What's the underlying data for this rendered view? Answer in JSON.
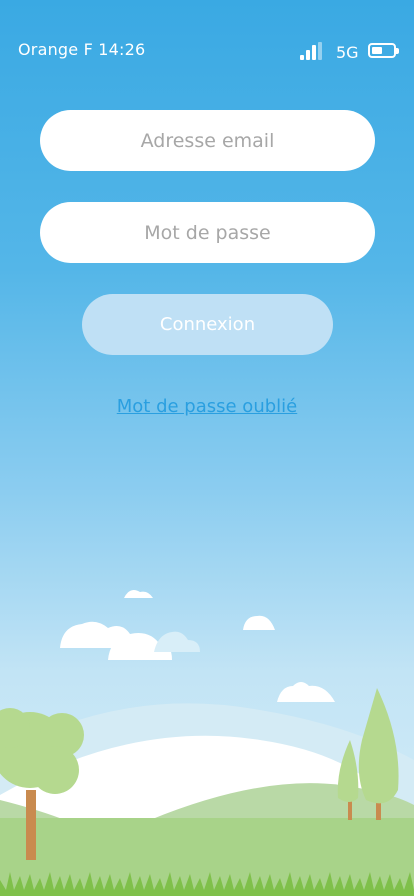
{
  "status_bar": {
    "carrier_time": "Orange F 14:26",
    "network": "5G",
    "battery_level": 0.5,
    "signal_icon": "signal-bars-icon",
    "battery_icon": "battery-icon"
  },
  "login": {
    "email_placeholder": "Adresse email",
    "email_value": "",
    "password_placeholder": "Mot de passe",
    "password_value": "",
    "submit_label": "Connexion",
    "forgot_link": "Mot de passe oublié"
  },
  "colors": {
    "sky_top": "#3aa9e3",
    "sky_bottom": "#d8eef8",
    "button_disabled": "#bfe0f5",
    "link": "#2a9fe0",
    "grass": "#a8d389",
    "tree": "#b5d98f"
  }
}
